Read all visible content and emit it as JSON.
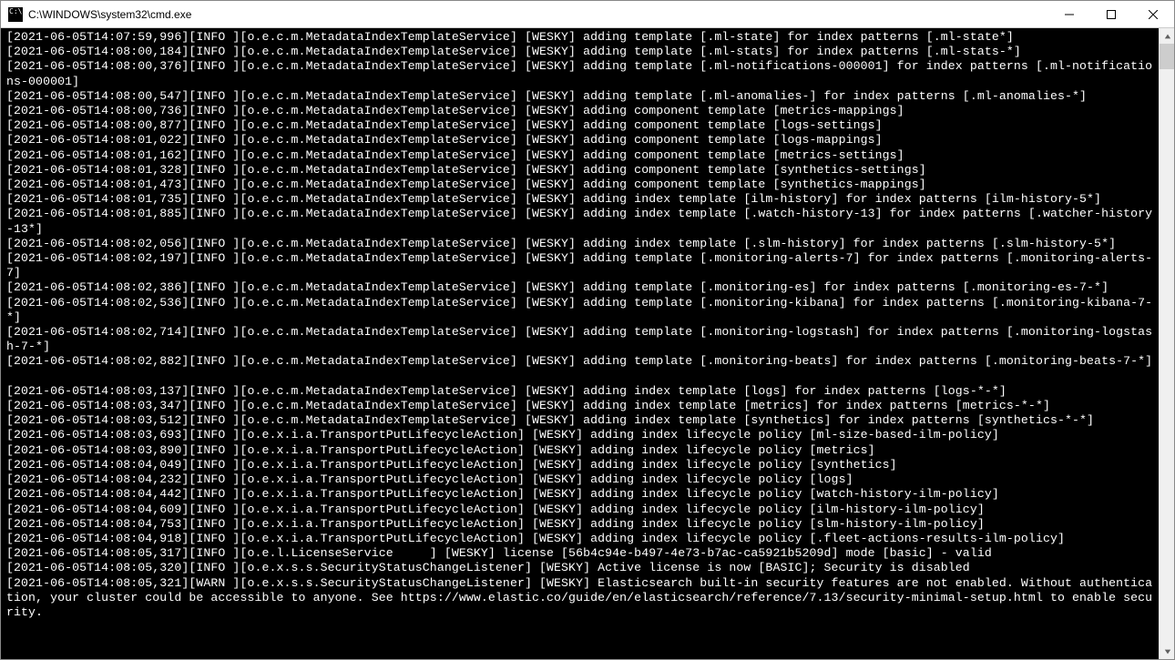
{
  "window": {
    "title": "C:\\WINDOWS\\system32\\cmd.exe"
  },
  "log_lines": [
    "[2021-06-05T14:07:59,996][INFO ][o.e.c.m.MetadataIndexTemplateService] [WESKY] adding template [.ml-state] for index patterns [.ml-state*]",
    "[2021-06-05T14:08:00,184][INFO ][o.e.c.m.MetadataIndexTemplateService] [WESKY] adding template [.ml-stats] for index patterns [.ml-stats-*]",
    "[2021-06-05T14:08:00,376][INFO ][o.e.c.m.MetadataIndexTemplateService] [WESKY] adding template [.ml-notifications-000001] for index patterns [.ml-notifications-000001]",
    "[2021-06-05T14:08:00,547][INFO ][o.e.c.m.MetadataIndexTemplateService] [WESKY] adding template [.ml-anomalies-] for index patterns [.ml-anomalies-*]",
    "[2021-06-05T14:08:00,736][INFO ][o.e.c.m.MetadataIndexTemplateService] [WESKY] adding component template [metrics-mappings]",
    "[2021-06-05T14:08:00,877][INFO ][o.e.c.m.MetadataIndexTemplateService] [WESKY] adding component template [logs-settings]",
    "[2021-06-05T14:08:01,022][INFO ][o.e.c.m.MetadataIndexTemplateService] [WESKY] adding component template [logs-mappings]",
    "[2021-06-05T14:08:01,162][INFO ][o.e.c.m.MetadataIndexTemplateService] [WESKY] adding component template [metrics-settings]",
    "[2021-06-05T14:08:01,328][INFO ][o.e.c.m.MetadataIndexTemplateService] [WESKY] adding component template [synthetics-settings]",
    "[2021-06-05T14:08:01,473][INFO ][o.e.c.m.MetadataIndexTemplateService] [WESKY] adding component template [synthetics-mappings]",
    "[2021-06-05T14:08:01,735][INFO ][o.e.c.m.MetadataIndexTemplateService] [WESKY] adding index template [ilm-history] for index patterns [ilm-history-5*]",
    "[2021-06-05T14:08:01,885][INFO ][o.e.c.m.MetadataIndexTemplateService] [WESKY] adding index template [.watch-history-13] for index patterns [.watcher-history-13*]",
    "[2021-06-05T14:08:02,056][INFO ][o.e.c.m.MetadataIndexTemplateService] [WESKY] adding index template [.slm-history] for index patterns [.slm-history-5*]",
    "[2021-06-05T14:08:02,197][INFO ][o.e.c.m.MetadataIndexTemplateService] [WESKY] adding template [.monitoring-alerts-7] for index patterns [.monitoring-alerts-7]",
    "[2021-06-05T14:08:02,386][INFO ][o.e.c.m.MetadataIndexTemplateService] [WESKY] adding template [.monitoring-es] for index patterns [.monitoring-es-7-*]",
    "[2021-06-05T14:08:02,536][INFO ][o.e.c.m.MetadataIndexTemplateService] [WESKY] adding template [.monitoring-kibana] for index patterns [.monitoring-kibana-7-*]",
    "[2021-06-05T14:08:02,714][INFO ][o.e.c.m.MetadataIndexTemplateService] [WESKY] adding template [.monitoring-logstash] for index patterns [.monitoring-logstash-7-*]",
    "[2021-06-05T14:08:02,882][INFO ][o.e.c.m.MetadataIndexTemplateService] [WESKY] adding template [.monitoring-beats] for index patterns [.monitoring-beats-7-*]",
    "",
    "[2021-06-05T14:08:03,137][INFO ][o.e.c.m.MetadataIndexTemplateService] [WESKY] adding index template [logs] for index patterns [logs-*-*]",
    "[2021-06-05T14:08:03,347][INFO ][o.e.c.m.MetadataIndexTemplateService] [WESKY] adding index template [metrics] for index patterns [metrics-*-*]",
    "[2021-06-05T14:08:03,512][INFO ][o.e.c.m.MetadataIndexTemplateService] [WESKY] adding index template [synthetics] for index patterns [synthetics-*-*]",
    "[2021-06-05T14:08:03,693][INFO ][o.e.x.i.a.TransportPutLifecycleAction] [WESKY] adding index lifecycle policy [ml-size-based-ilm-policy]",
    "[2021-06-05T14:08:03,890][INFO ][o.e.x.i.a.TransportPutLifecycleAction] [WESKY] adding index lifecycle policy [metrics]",
    "[2021-06-05T14:08:04,049][INFO ][o.e.x.i.a.TransportPutLifecycleAction] [WESKY] adding index lifecycle policy [synthetics]",
    "[2021-06-05T14:08:04,232][INFO ][o.e.x.i.a.TransportPutLifecycleAction] [WESKY] adding index lifecycle policy [logs]",
    "[2021-06-05T14:08:04,442][INFO ][o.e.x.i.a.TransportPutLifecycleAction] [WESKY] adding index lifecycle policy [watch-history-ilm-policy]",
    "[2021-06-05T14:08:04,609][INFO ][o.e.x.i.a.TransportPutLifecycleAction] [WESKY] adding index lifecycle policy [ilm-history-ilm-policy]",
    "[2021-06-05T14:08:04,753][INFO ][o.e.x.i.a.TransportPutLifecycleAction] [WESKY] adding index lifecycle policy [slm-history-ilm-policy]",
    "[2021-06-05T14:08:04,918][INFO ][o.e.x.i.a.TransportPutLifecycleAction] [WESKY] adding index lifecycle policy [.fleet-actions-results-ilm-policy]",
    "[2021-06-05T14:08:05,317][INFO ][o.e.l.LicenseService     ] [WESKY] license [56b4c94e-b497-4e73-b7ac-ca5921b5209d] mode [basic] - valid",
    "[2021-06-05T14:08:05,320][INFO ][o.e.x.s.s.SecurityStatusChangeListener] [WESKY] Active license is now [BASIC]; Security is disabled",
    "[2021-06-05T14:08:05,321][WARN ][o.e.x.s.s.SecurityStatusChangeListener] [WESKY] Elasticsearch built-in security features are not enabled. Without authentication, your cluster could be accessible to anyone. See https://www.elastic.co/guide/en/elasticsearch/reference/7.13/security-minimal-setup.html to enable security."
  ]
}
